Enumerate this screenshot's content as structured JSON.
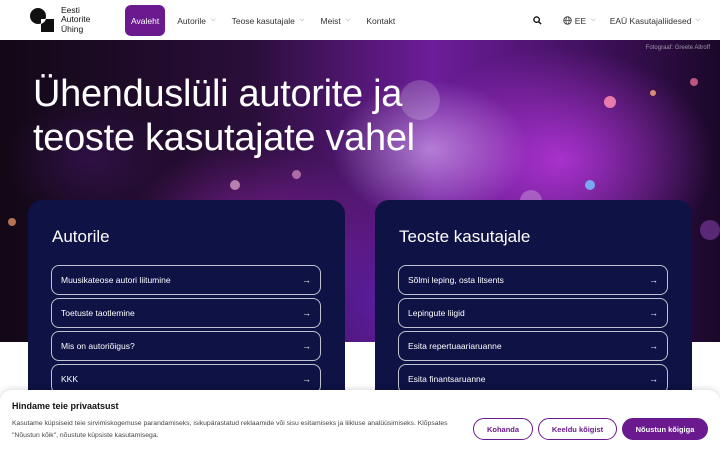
{
  "header": {
    "logo": {
      "line1": "Eesti",
      "line2": "Autorite",
      "line3": "Ühing"
    },
    "nav": [
      {
        "label": "Avaleht",
        "active": true,
        "dropdown": false
      },
      {
        "label": "Autorile",
        "active": false,
        "dropdown": true
      },
      {
        "label": "Teose kasutajale",
        "active": false,
        "dropdown": true
      },
      {
        "label": "Meist",
        "active": false,
        "dropdown": true
      },
      {
        "label": "Kontakt",
        "active": false,
        "dropdown": false
      }
    ],
    "search_icon": "search-icon",
    "language": {
      "icon": "globe-icon",
      "label": "EE"
    },
    "users_link": "EAÜ Kasutajaliidesed"
  },
  "hero": {
    "photo_credit": "Fotograaf: Greete Altroff",
    "title": "Ühenduslüli autorite ja teoste kasutajate vahel"
  },
  "cards": [
    {
      "title": "Autorile",
      "links": [
        "Muusikateose autori liitumine",
        "Toetuste taotlemine",
        "Mis on autoriõigus?",
        "KKK"
      ]
    },
    {
      "title": "Teoste kasutajale",
      "links": [
        "Sõlmi leping, osta litsents",
        "Lepingute liigid",
        "Esita repertuaariaruanne",
        "Esita finantsaruanne"
      ]
    }
  ],
  "cookie": {
    "title": "Hindame teie privaatsust",
    "text": "Kasutame küpsiseid teie sirvimiskogemuse parandamiseks, isikupärastatud reklaamide või sisu esitamiseks ja liikluse analüüsimiseks. Klõpsates \"Nõustun kõik\", nõustute küpsiste kasutamisega.",
    "customize": "Kohanda",
    "reject": "Keeldu kõigist",
    "accept": "Nõustun kõigiga"
  },
  "colors": {
    "accent": "#6a1a8e",
    "card_bg": "#0e1244"
  }
}
